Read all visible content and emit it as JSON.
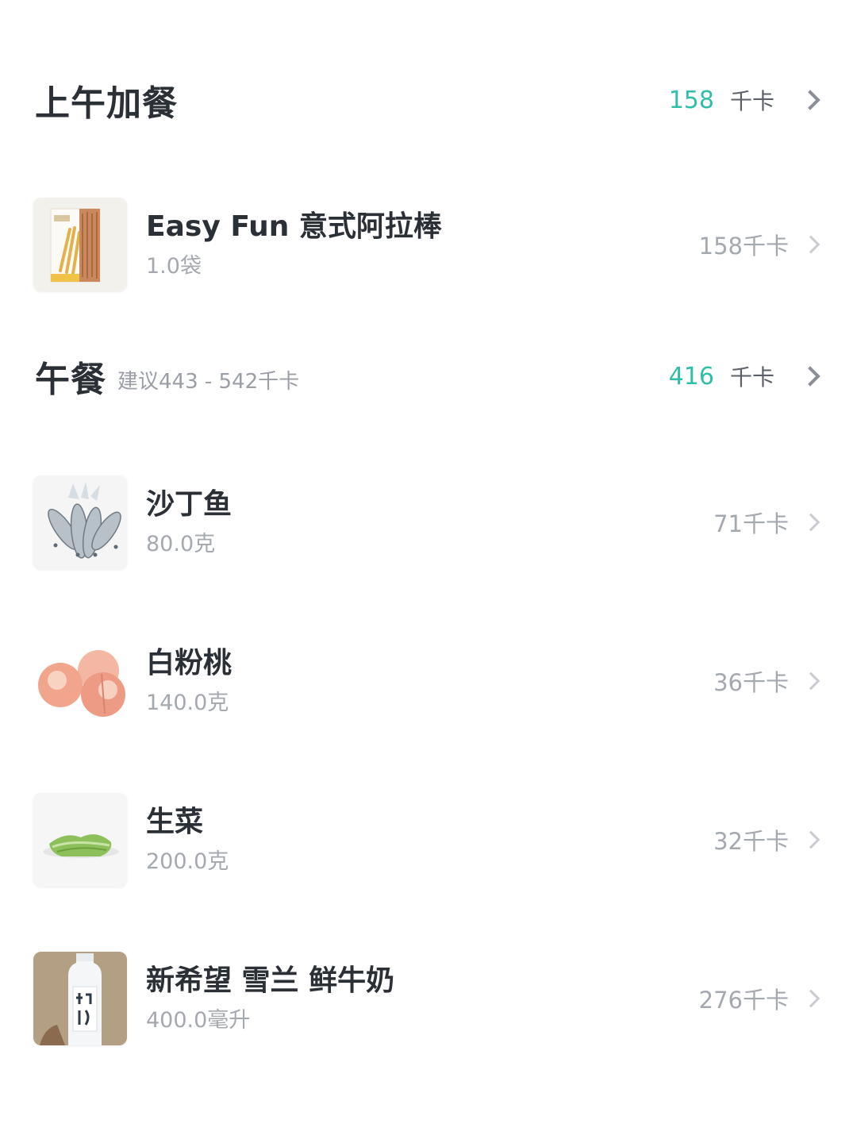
{
  "snack": {
    "title": "上午加餐",
    "kcal": "158",
    "unit": "千卡",
    "items": [
      {
        "name": "Easy Fun 意式阿拉棒",
        "amount": "1.0袋",
        "kcal": "158千卡",
        "icon": "breadstick-box-image"
      }
    ]
  },
  "lunch": {
    "title": "午餐",
    "hint": "建议443 - 542千卡",
    "kcal": "416",
    "unit": "千卡",
    "items": [
      {
        "name": "沙丁鱼",
        "amount": "80.0克",
        "kcal": "71千卡",
        "icon": "sardine-image"
      },
      {
        "name": "白粉桃",
        "amount": "140.0克",
        "kcal": "36千卡",
        "icon": "peach-image"
      },
      {
        "name": "生菜",
        "amount": "200.0克",
        "kcal": "32千卡",
        "icon": "lettuce-image"
      },
      {
        "name": "新希望 雪兰 鲜牛奶",
        "amount": "400.0毫升",
        "kcal": "276千卡",
        "icon": "milk-bottle-image"
      }
    ]
  },
  "colors": {
    "accent": "#2fbfa8",
    "title": "#2b2f36",
    "muted": "#a4a8af"
  }
}
